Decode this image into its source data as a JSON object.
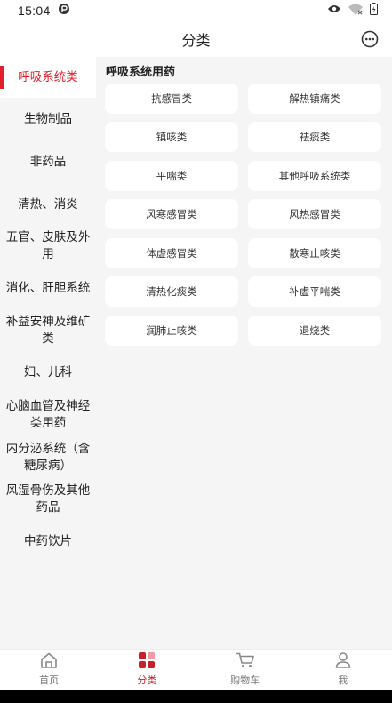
{
  "status_bar": {
    "time": "15:04"
  },
  "header": {
    "title": "分类",
    "menu_icon": "chat-bubble-icon"
  },
  "colors": {
    "accent": "#e0212d",
    "sidebar_bg": "#f5f5f5",
    "chip_bg": "#ffffff"
  },
  "sidebar": {
    "items": [
      {
        "label": "呼吸系统类",
        "active": true
      },
      {
        "label": "生物制品",
        "active": false
      },
      {
        "label": "非药品",
        "active": false
      },
      {
        "label": "清热、消炎",
        "active": false
      },
      {
        "label": "五官、皮肤及外用",
        "active": false
      },
      {
        "label": "消化、肝胆系统",
        "active": false
      },
      {
        "label": "补益安神及维矿类",
        "active": false
      },
      {
        "label": "妇、儿科",
        "active": false
      },
      {
        "label": "心脑血管及神经类用药",
        "active": false
      },
      {
        "label": "内分泌系统（含糖尿病）",
        "active": false
      },
      {
        "label": "风湿骨伤及其他药品",
        "active": false
      },
      {
        "label": "中药饮片",
        "active": false
      }
    ]
  },
  "main": {
    "section_title": "呼吸系统用药",
    "subcategories": [
      "抗感冒类",
      "解热镇痛类",
      "镇咳类",
      "祛痰类",
      "平喘类",
      "其他呼吸系统类",
      "风寒感冒类",
      "风热感冒类",
      "体虚感冒类",
      "散寒止咳类",
      "清热化痰类",
      "补虚平喘类",
      "润肺止咳类",
      "退烧类"
    ]
  },
  "tabbar": {
    "tabs": [
      {
        "label": "首页",
        "icon": "home-icon",
        "active": false
      },
      {
        "label": "分类",
        "icon": "category-icon",
        "active": true
      },
      {
        "label": "购物车",
        "icon": "cart-icon",
        "active": false
      },
      {
        "label": "我",
        "icon": "user-icon",
        "active": false
      }
    ]
  }
}
